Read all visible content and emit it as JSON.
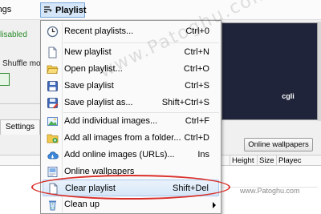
{
  "menubar": {
    "settings_label": "ttings",
    "playlist_label": "Playlist"
  },
  "left_panel": {
    "status_text": "lisabled",
    "shuffle_text": "Shuffle mo",
    "settings_tab": "Settings"
  },
  "right_panel": {
    "preview_logo": "cgli",
    "online_button": "Online wallpapers",
    "columns": [
      "Height",
      "Size",
      "Playec"
    ]
  },
  "dropdown": {
    "items": [
      {
        "label": "Recent playlists...",
        "shortcut": "Ctrl+0",
        "icon": "clock-icon"
      },
      {
        "label": "New playlist",
        "shortcut": "Ctrl+N",
        "icon": "new-document-icon"
      },
      {
        "label": "Open playlist...",
        "shortcut": "Ctrl+O",
        "icon": "folder-open-icon"
      },
      {
        "label": "Save playlist",
        "shortcut": "Ctrl+S",
        "icon": "save-icon"
      },
      {
        "label": "Save playlist as...",
        "shortcut": "Shift+Ctrl+S",
        "icon": "save-as-icon"
      },
      {
        "label": "Add individual images...",
        "shortcut": "Ctrl+F",
        "icon": "add-image-icon"
      },
      {
        "label": "Add all images from a folder...",
        "shortcut": "Ctrl+D",
        "icon": "add-folder-icon"
      },
      {
        "label": "Add online images (URLs)...",
        "shortcut": "Ins",
        "icon": "cloud-icon"
      },
      {
        "label": "Online wallpapers",
        "shortcut": "",
        "icon": "online-wallpapers-icon"
      },
      {
        "label": "Clear playlist",
        "shortcut": "Shift+Del",
        "icon": "clear-document-icon"
      },
      {
        "label": "Clean up",
        "shortcut": "",
        "icon": "recycle-icon"
      }
    ]
  },
  "watermarks": {
    "diagonal": "www.Patoghu.com",
    "inline": "www.Patoghu.com"
  },
  "colors": {
    "highlight_ellipse": "#d9302a",
    "menu_hover": "#d7e7f8",
    "status_green": "#2a8a2a"
  }
}
